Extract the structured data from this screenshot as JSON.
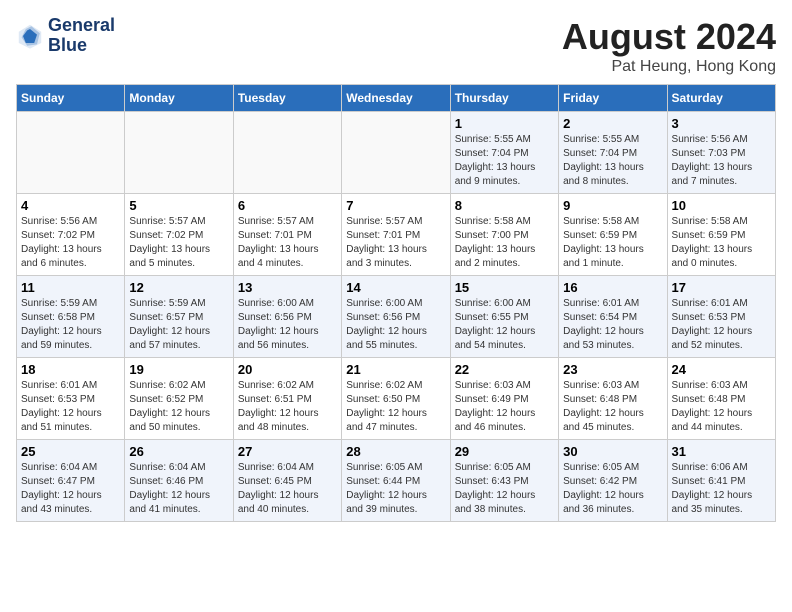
{
  "logo": {
    "line1": "General",
    "line2": "Blue"
  },
  "title": "August 2024",
  "subtitle": "Pat Heung, Hong Kong",
  "days_of_week": [
    "Sunday",
    "Monday",
    "Tuesday",
    "Wednesday",
    "Thursday",
    "Friday",
    "Saturday"
  ],
  "weeks": [
    [
      {
        "day": "",
        "info": ""
      },
      {
        "day": "",
        "info": ""
      },
      {
        "day": "",
        "info": ""
      },
      {
        "day": "",
        "info": ""
      },
      {
        "day": "1",
        "info": "Sunrise: 5:55 AM\nSunset: 7:04 PM\nDaylight: 13 hours\nand 9 minutes."
      },
      {
        "day": "2",
        "info": "Sunrise: 5:55 AM\nSunset: 7:04 PM\nDaylight: 13 hours\nand 8 minutes."
      },
      {
        "day": "3",
        "info": "Sunrise: 5:56 AM\nSunset: 7:03 PM\nDaylight: 13 hours\nand 7 minutes."
      }
    ],
    [
      {
        "day": "4",
        "info": "Sunrise: 5:56 AM\nSunset: 7:02 PM\nDaylight: 13 hours\nand 6 minutes."
      },
      {
        "day": "5",
        "info": "Sunrise: 5:57 AM\nSunset: 7:02 PM\nDaylight: 13 hours\nand 5 minutes."
      },
      {
        "day": "6",
        "info": "Sunrise: 5:57 AM\nSunset: 7:01 PM\nDaylight: 13 hours\nand 4 minutes."
      },
      {
        "day": "7",
        "info": "Sunrise: 5:57 AM\nSunset: 7:01 PM\nDaylight: 13 hours\nand 3 minutes."
      },
      {
        "day": "8",
        "info": "Sunrise: 5:58 AM\nSunset: 7:00 PM\nDaylight: 13 hours\nand 2 minutes."
      },
      {
        "day": "9",
        "info": "Sunrise: 5:58 AM\nSunset: 6:59 PM\nDaylight: 13 hours\nand 1 minute."
      },
      {
        "day": "10",
        "info": "Sunrise: 5:58 AM\nSunset: 6:59 PM\nDaylight: 13 hours\nand 0 minutes."
      }
    ],
    [
      {
        "day": "11",
        "info": "Sunrise: 5:59 AM\nSunset: 6:58 PM\nDaylight: 12 hours\nand 59 minutes."
      },
      {
        "day": "12",
        "info": "Sunrise: 5:59 AM\nSunset: 6:57 PM\nDaylight: 12 hours\nand 57 minutes."
      },
      {
        "day": "13",
        "info": "Sunrise: 6:00 AM\nSunset: 6:56 PM\nDaylight: 12 hours\nand 56 minutes."
      },
      {
        "day": "14",
        "info": "Sunrise: 6:00 AM\nSunset: 6:56 PM\nDaylight: 12 hours\nand 55 minutes."
      },
      {
        "day": "15",
        "info": "Sunrise: 6:00 AM\nSunset: 6:55 PM\nDaylight: 12 hours\nand 54 minutes."
      },
      {
        "day": "16",
        "info": "Sunrise: 6:01 AM\nSunset: 6:54 PM\nDaylight: 12 hours\nand 53 minutes."
      },
      {
        "day": "17",
        "info": "Sunrise: 6:01 AM\nSunset: 6:53 PM\nDaylight: 12 hours\nand 52 minutes."
      }
    ],
    [
      {
        "day": "18",
        "info": "Sunrise: 6:01 AM\nSunset: 6:53 PM\nDaylight: 12 hours\nand 51 minutes."
      },
      {
        "day": "19",
        "info": "Sunrise: 6:02 AM\nSunset: 6:52 PM\nDaylight: 12 hours\nand 50 minutes."
      },
      {
        "day": "20",
        "info": "Sunrise: 6:02 AM\nSunset: 6:51 PM\nDaylight: 12 hours\nand 48 minutes."
      },
      {
        "day": "21",
        "info": "Sunrise: 6:02 AM\nSunset: 6:50 PM\nDaylight: 12 hours\nand 47 minutes."
      },
      {
        "day": "22",
        "info": "Sunrise: 6:03 AM\nSunset: 6:49 PM\nDaylight: 12 hours\nand 46 minutes."
      },
      {
        "day": "23",
        "info": "Sunrise: 6:03 AM\nSunset: 6:48 PM\nDaylight: 12 hours\nand 45 minutes."
      },
      {
        "day": "24",
        "info": "Sunrise: 6:03 AM\nSunset: 6:48 PM\nDaylight: 12 hours\nand 44 minutes."
      }
    ],
    [
      {
        "day": "25",
        "info": "Sunrise: 6:04 AM\nSunset: 6:47 PM\nDaylight: 12 hours\nand 43 minutes."
      },
      {
        "day": "26",
        "info": "Sunrise: 6:04 AM\nSunset: 6:46 PM\nDaylight: 12 hours\nand 41 minutes."
      },
      {
        "day": "27",
        "info": "Sunrise: 6:04 AM\nSunset: 6:45 PM\nDaylight: 12 hours\nand 40 minutes."
      },
      {
        "day": "28",
        "info": "Sunrise: 6:05 AM\nSunset: 6:44 PM\nDaylight: 12 hours\nand 39 minutes."
      },
      {
        "day": "29",
        "info": "Sunrise: 6:05 AM\nSunset: 6:43 PM\nDaylight: 12 hours\nand 38 minutes."
      },
      {
        "day": "30",
        "info": "Sunrise: 6:05 AM\nSunset: 6:42 PM\nDaylight: 12 hours\nand 36 minutes."
      },
      {
        "day": "31",
        "info": "Sunrise: 6:06 AM\nSunset: 6:41 PM\nDaylight: 12 hours\nand 35 minutes."
      }
    ]
  ]
}
